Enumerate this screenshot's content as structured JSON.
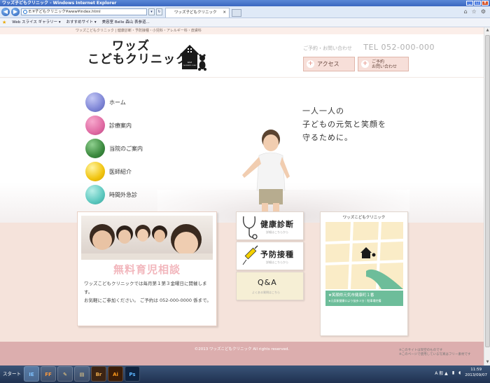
{
  "window": {
    "title": "ワッズ子どもクリニック - Windows Internet Explorer"
  },
  "browser": {
    "address": "E:¥子どもクリニック¥www¥index.html",
    "tab_title": "ワッズ子どもクリニック",
    "tab_close": "✕",
    "favorites": [
      {
        "label": "Web スライス ギャラリー ▾"
      },
      {
        "label": "おすすめサイト ▾"
      },
      {
        "label": "美容室 Belle 森山 表参道..."
      }
    ]
  },
  "page": {
    "breadcrumb": "ワッズこどもクリニック | 健康診断・予防接種・小児科・アレルギー科・皮膚科",
    "logo": {
      "line1": "ワッズ",
      "line2": "こどもクリニック",
      "sign_line1": "WAZ",
      "sign_line2": "CHILDREN'S CLINIC"
    },
    "contact": {
      "label": "ご予約・お問い合わせ",
      "tel": "TEL 052-000-000"
    },
    "buttons": {
      "access": "アクセス",
      "reserve_line1": "ご予約",
      "reserve_line2": "お問い合わせ"
    },
    "nav": [
      {
        "label": "ホーム",
        "color": "#7f86d6"
      },
      {
        "label": "診療案内",
        "color": "#e06ba3"
      },
      {
        "label": "当院のご案内",
        "color": "#3c8a3f"
      },
      {
        "label": "医師紹介",
        "color": "#f1c40f"
      },
      {
        "label": "時間外急診",
        "color": "#5dc8bf"
      }
    ],
    "tagline": [
      "一人一人の",
      "子どもの元気と笑顔を",
      "守るために。"
    ],
    "consult": {
      "title": "無料育児相談",
      "desc_line1": "ワッズこどもクリニックでは毎月第１第３金曜日に開催します。",
      "desc_line2": "お気軽にご参加ください。 ご予約は 052-000-0000  係まで。"
    },
    "cards": [
      {
        "title": "健康診断",
        "sub": "詳細はこちらから"
      },
      {
        "title": "予防接種",
        "sub": "詳細はこちらから"
      },
      {
        "title": "Q&A",
        "sub": "よくある質問はこちら"
      }
    ],
    "map": {
      "title": "ワッズこどもクリニック",
      "address": "★笑顔県元気市健康町１番",
      "access": "★元気駅健康口より徒歩３分｜駐車場完備"
    },
    "footer": {
      "copyright": "©2013 ワッズこどもクリニック All rights reserved.",
      "notice_line1": "※このサイトは架空のものです",
      "notice_line2": "※このページで使用している写真はフリー素材です"
    }
  },
  "taskbar": {
    "start": "スタート",
    "apps": [
      "IE",
      "FF",
      "✎",
      "▤",
      "Br",
      "Ai",
      "Ps"
    ],
    "tray_ime": "A 般 ▲",
    "time": "11:59",
    "date": "2013/09/07"
  }
}
